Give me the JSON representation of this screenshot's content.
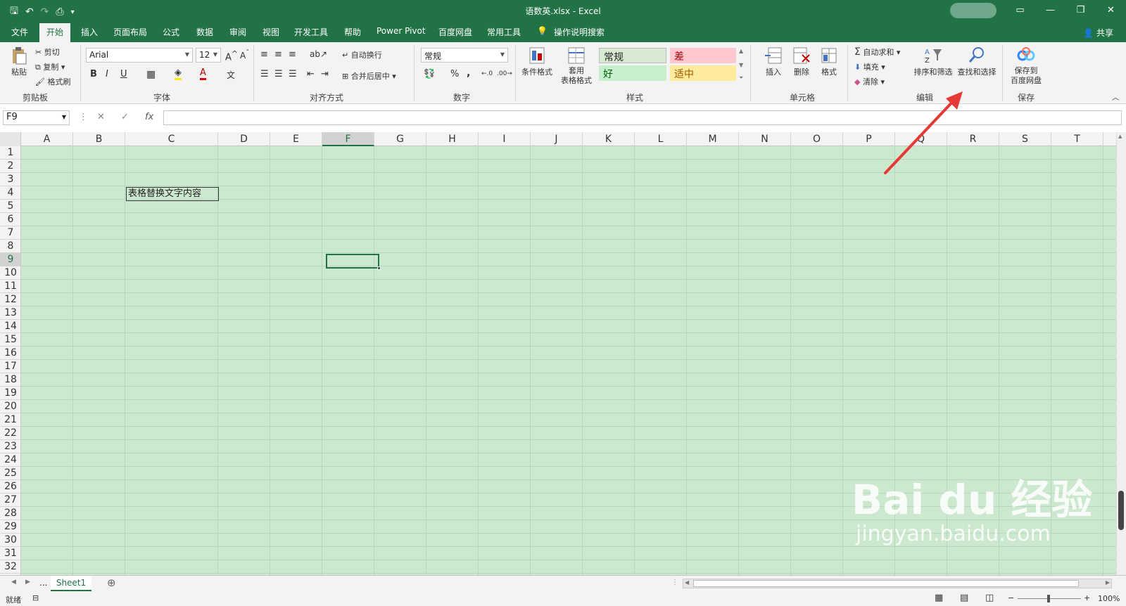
{
  "window": {
    "title": "语数英.xlsx  -  Excel"
  },
  "tabs": [
    {
      "label": "文件"
    },
    {
      "label": "开始"
    },
    {
      "label": "插入"
    },
    {
      "label": "页面布局"
    },
    {
      "label": "公式"
    },
    {
      "label": "数据"
    },
    {
      "label": "审阅"
    },
    {
      "label": "视图"
    },
    {
      "label": "开发工具"
    },
    {
      "label": "帮助"
    },
    {
      "label": "Power Pivot"
    },
    {
      "label": "百度网盘"
    },
    {
      "label": "常用工具"
    }
  ],
  "tell_me": "操作说明搜索",
  "share": "共享",
  "ribbon": {
    "clipboard": {
      "paste": "粘贴",
      "cut": "剪切",
      "copy": "复制",
      "format_painter": "格式刷",
      "label": "剪贴板"
    },
    "font": {
      "name": "Arial",
      "size": "12",
      "bold": "B",
      "italic": "I",
      "underline": "U",
      "label": "字体"
    },
    "alignment": {
      "wrap": "自动换行",
      "merge": "合并后居中",
      "label": "对齐方式"
    },
    "number": {
      "format": "常规",
      "percent": "%",
      "comma": ",",
      "label": "数字"
    },
    "styles": {
      "conditional": "条件格式",
      "table_l1": "套用",
      "table_l2": "表格格式",
      "normal": "常规",
      "bad": "差",
      "good": "好",
      "neutral": "适中",
      "label": "样式"
    },
    "cells": {
      "insert": "插入",
      "delete": "删除",
      "format": "格式",
      "label": "单元格"
    },
    "editing": {
      "autosum": "自动求和",
      "fill": "填充",
      "clear": "清除",
      "sort_filter": "排序和筛选",
      "find_select": "查找和选择",
      "label": "编辑"
    },
    "save": {
      "line1": "保存到",
      "line2": "百度网盘",
      "label": "保存"
    }
  },
  "formula_bar": {
    "name_box": "F9",
    "fx": "fx",
    "content": ""
  },
  "columns": [
    "A",
    "B",
    "C",
    "D",
    "E",
    "F",
    "G",
    "H",
    "I",
    "J",
    "K",
    "L",
    "M",
    "N",
    "O",
    "P",
    "Q",
    "R",
    "S",
    "T"
  ],
  "selected_column": "F",
  "rows": [
    "1",
    "2",
    "3",
    "4",
    "5",
    "6",
    "7",
    "8",
    "9",
    "10",
    "11",
    "12",
    "13",
    "14",
    "15",
    "16",
    "17",
    "18",
    "19",
    "20",
    "21",
    "22",
    "23",
    "24",
    "25",
    "26",
    "27",
    "28",
    "29",
    "30",
    "31",
    "32"
  ],
  "selected_row": "9",
  "cells": {
    "C4": "表格替换文字内容"
  },
  "sheet": {
    "name": "Sheet1",
    "dots": "..."
  },
  "status": {
    "ready": "就绪",
    "zoom": "100%"
  },
  "watermark": {
    "brand": "Bai  du 经验",
    "url": "jingyan.baidu.com"
  },
  "colors": {
    "accent": "#217346",
    "sheet_bg": "#cce8cf",
    "arrow": "#e53935"
  }
}
